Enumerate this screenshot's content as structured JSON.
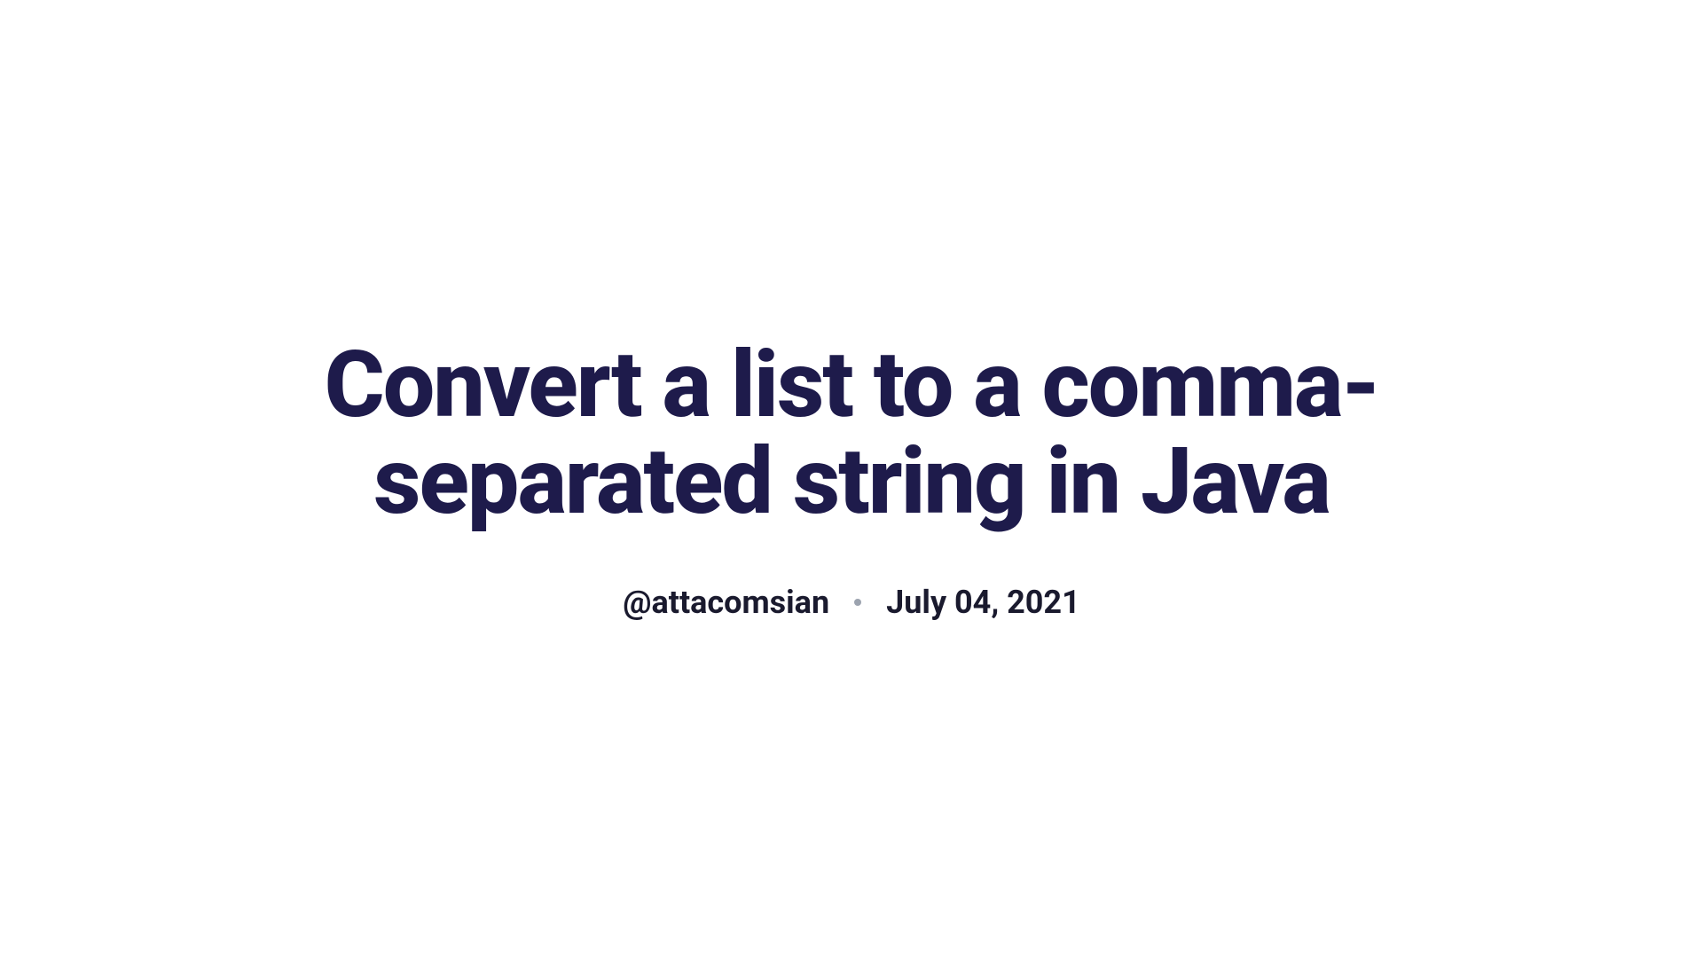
{
  "article": {
    "title": "Convert a list to a comma-separated string in Java",
    "author": "@attacomsian",
    "date": "July 04, 2021"
  }
}
